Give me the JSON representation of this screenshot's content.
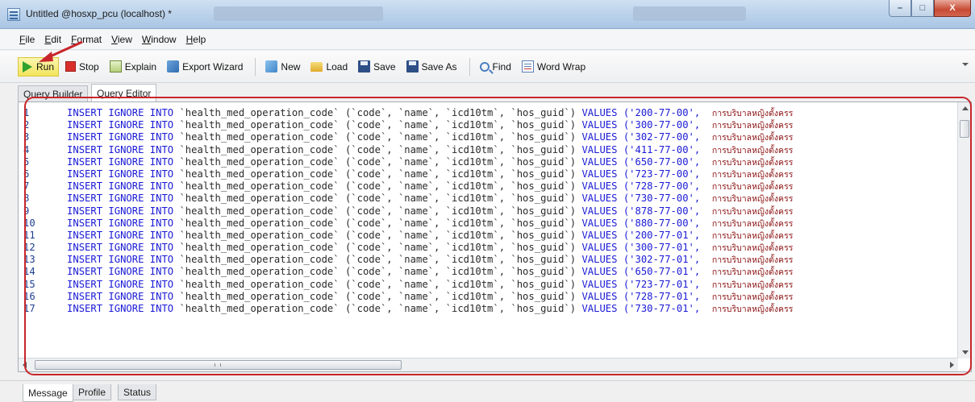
{
  "window": {
    "title": "Untitled @hosxp_pcu (localhost) *",
    "controls": {
      "minimize": "–",
      "maximize": "□",
      "close": "X"
    }
  },
  "menu": [
    "File",
    "Edit",
    "Format",
    "View",
    "Window",
    "Help"
  ],
  "toolbar": {
    "run": "Run",
    "stop": "Stop",
    "explain": "Explain",
    "export_wizard": "Export Wizard",
    "new": "New",
    "load": "Load",
    "save": "Save",
    "save_as": "Save As",
    "find": "Find",
    "word_wrap": "Word Wrap"
  },
  "tabs": [
    "Query Builder",
    "Query Editor"
  ],
  "editor": {
    "keyword_insert": "INSERT",
    "keyword_ignore": "IGNORE",
    "keyword_into": "INTO",
    "table": "`health_med_operation_code`",
    "columns": "(`code`, `name`, `icd10tm`, `hos_guid`)",
    "keyword_values": "VALUES",
    "thai_fragment": "การบริบาลหญิงตั้งครร",
    "lines": [
      {
        "num": "1",
        "code": "('200-77-00',"
      },
      {
        "num": "2",
        "code": "('300-77-00',"
      },
      {
        "num": "3",
        "code": "('302-77-00',"
      },
      {
        "num": "4",
        "code": "('411-77-00',"
      },
      {
        "num": "5",
        "code": "('650-77-00',"
      },
      {
        "num": "6",
        "code": "('723-77-00',"
      },
      {
        "num": "7",
        "code": "('728-77-00',"
      },
      {
        "num": "8",
        "code": "('730-77-00',"
      },
      {
        "num": "9",
        "code": "('878-77-00',"
      },
      {
        "num": "10",
        "code": "('880-77-00',"
      },
      {
        "num": "11",
        "code": "('200-77-01',"
      },
      {
        "num": "12",
        "code": "('300-77-01',"
      },
      {
        "num": "13",
        "code": "('302-77-01',"
      },
      {
        "num": "14",
        "code": "('650-77-01',"
      },
      {
        "num": "15",
        "code": "('723-77-01',"
      },
      {
        "num": "16",
        "code": "('728-77-01',"
      },
      {
        "num": "17",
        "code": "('730-77-01',"
      }
    ],
    "hscroll_grip": "III"
  },
  "bottom_tabs": [
    "Message",
    "Profile",
    "Status"
  ],
  "colors": {
    "annotation_red": "#c8262b",
    "run_highlight": "#f2e45c",
    "keyword_blue": "#1a1ad6",
    "thai_text": "#8b1010"
  }
}
